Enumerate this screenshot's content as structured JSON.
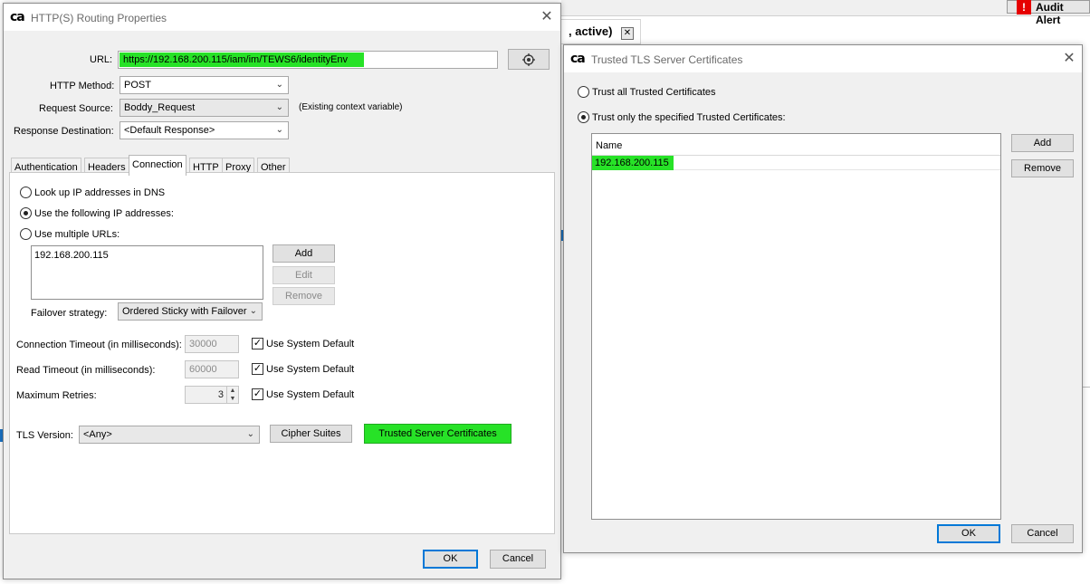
{
  "background": {
    "audit_label": "Audit Alert",
    "audit_badge": "!",
    "tab_label": ", active)",
    "tab_close": "✕"
  },
  "routing_dialog": {
    "logo": "ca",
    "title": "HTTP(S) Routing Properties",
    "close": "✕",
    "url_label": "URL:",
    "url_value": "https://192.168.200.115/iam/im/TEWS6/identityEnv",
    "url_button_icon": "settings-icon",
    "http_method_label": "HTTP Method:",
    "http_method_value": "POST",
    "request_source_label": "Request Source:",
    "request_source_value": "Boddy_Request",
    "request_source_note": "(Existing context variable)",
    "response_destination_label": "Response Destination:",
    "response_destination_value": "<Default Response>",
    "tabs": [
      "Authentication",
      "Headers",
      "Connection",
      "HTTP",
      "Proxy",
      "Other"
    ],
    "selected_tab": "Connection",
    "connection": {
      "lookup_dns_label": "Look up IP addresses in DNS",
      "use_ips_label": "Use the following IP addresses:",
      "use_urls_label": "Use multiple URLs:",
      "ip_list": [
        "192.168.200.115"
      ],
      "add_label": "Add",
      "edit_label": "Edit",
      "remove_label": "Remove",
      "failover_label": "Failover strategy:",
      "failover_value": "Ordered Sticky with Failover",
      "connection_timeout_label": "Connection Timeout (in milliseconds):",
      "connection_timeout_value": "30000",
      "read_timeout_label": "Read Timeout (in milliseconds):",
      "read_timeout_value": "60000",
      "max_retries_label": "Maximum Retries:",
      "max_retries_value": "3",
      "use_system_default_label": "Use System Default",
      "tls_version_label": "TLS Version:",
      "tls_version_value": "<Any>",
      "cipher_suites_label": "Cipher Suites",
      "trusted_certs_label": "Trusted Server Certificates"
    },
    "ok_label": "OK",
    "cancel_label": "Cancel"
  },
  "tls_dialog": {
    "logo": "ca",
    "title": "Trusted TLS Server Certificates",
    "close": "✕",
    "trust_all_label": "Trust all Trusted Certificates",
    "trust_specified_label": "Trust only the specified Trusted Certificates:",
    "column_name": "Name",
    "rows": [
      "192.168.200.115"
    ],
    "add_label": "Add",
    "remove_label": "Remove",
    "ok_label": "OK",
    "cancel_label": "Cancel"
  },
  "colors": {
    "highlight": "#27e227",
    "focus_border": "#0078d7",
    "dialog_bg": "#f0f0f0"
  }
}
